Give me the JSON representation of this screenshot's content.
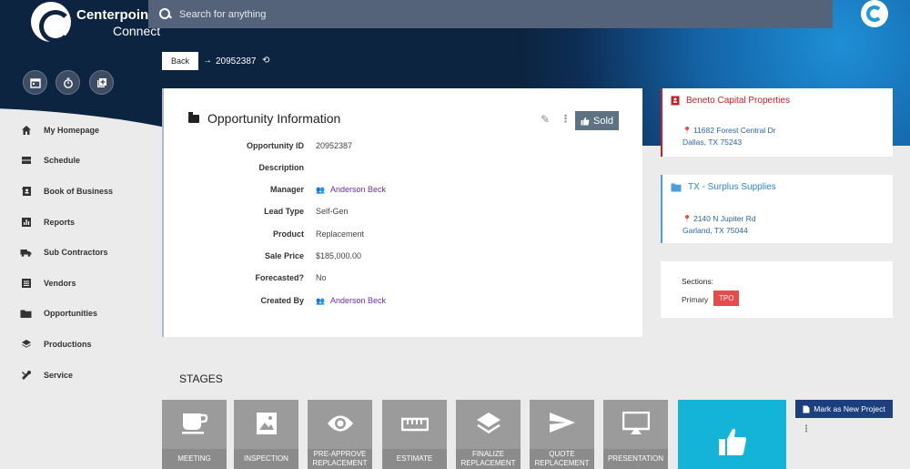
{
  "app": {
    "brand_line1": "Centerpoint",
    "brand_line2": "Connect"
  },
  "search": {
    "placeholder": "Search for anything"
  },
  "quick_actions": [
    {
      "icon": "calendar-icon"
    },
    {
      "icon": "timer-icon"
    },
    {
      "icon": "add-library-icon"
    }
  ],
  "sidebar": {
    "items": [
      {
        "label": "My Homepage",
        "icon": "home-icon"
      },
      {
        "label": "Schedule",
        "icon": "schedule-icon"
      },
      {
        "label": "Book of Business",
        "icon": "contacts-book-icon"
      },
      {
        "label": "Reports",
        "icon": "bar-chart-icon"
      },
      {
        "label": "Sub Contractors",
        "icon": "truck-icon"
      },
      {
        "label": "Vendors",
        "icon": "list-icon"
      },
      {
        "label": "Opportunities",
        "icon": "folder-icon"
      },
      {
        "label": "Productions",
        "icon": "layers-icon"
      },
      {
        "label": "Service",
        "icon": "tools-icon"
      }
    ]
  },
  "breadcrumb": {
    "back_label": "Back",
    "current_id": "20952387"
  },
  "opportunity": {
    "title": "Opportunity Information",
    "status_label": "Sold",
    "fields": [
      {
        "label": "Opportunity ID",
        "value": "20952387"
      },
      {
        "label": "Description",
        "value": ""
      },
      {
        "label": "Manager",
        "value": "Anderson Beck"
      },
      {
        "label": "Lead Type",
        "value": "Self-Gen"
      },
      {
        "label": "Product",
        "value": "Replacement"
      },
      {
        "label": "Sale Price",
        "value": "$185,000.00"
      },
      {
        "label": "Forecasted?",
        "value": "No"
      },
      {
        "label": "Created By",
        "value": "Anderson Beck"
      }
    ]
  },
  "customer": {
    "name": "Beneto Capital Properties",
    "address1": "11682 Forest Central Dr",
    "address2": "Dallas, TX 75243"
  },
  "supplier": {
    "name": "TX - Surplus Supplies",
    "address1": "2140 N Jupiter Rd",
    "address2": "Garland, TX 75044"
  },
  "sections": {
    "label": "Sections:",
    "primary_label": "Primary",
    "badge": "TPO"
  },
  "stages": {
    "title": "STAGES",
    "items": [
      {
        "label": "MEETING",
        "icon": "coffee-cup-icon"
      },
      {
        "label": "INSPECTION",
        "icon": "image-icon"
      },
      {
        "label": "PRE-APPROVE REPLACEMENT",
        "icon": "eye-icon"
      },
      {
        "label": "ESTIMATE",
        "icon": "ruler-icon"
      },
      {
        "label": "FINALIZE REPLACEMENT",
        "icon": "layers-icon"
      },
      {
        "label": "QUOTE REPLACEMENT",
        "icon": "send-icon"
      },
      {
        "label": "PRESENTATION",
        "icon": "presentation-icon"
      }
    ],
    "active_icon": "thumbs-up-icon"
  },
  "actions": {
    "mark_new_project": "Mark as New Project"
  },
  "colors": {
    "header": "#0d2440",
    "accent_blue": "#14b4d9",
    "sold_button": "#5e7281",
    "badge_red": "#e74c4c",
    "link_purple": "#6a2ab0"
  }
}
